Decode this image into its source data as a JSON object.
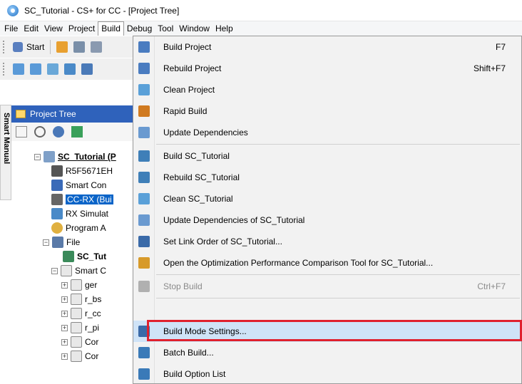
{
  "window": {
    "title": "SC_Tutorial - CS+ for CC - [Project Tree]"
  },
  "menubar": {
    "items": [
      "File",
      "Edit",
      "View",
      "Project",
      "Build",
      "Debug",
      "Tool",
      "Window",
      "Help"
    ],
    "open_item": "Build"
  },
  "toolbar": {
    "start_label": "Start"
  },
  "side_tab": {
    "label": "Smart Manual"
  },
  "project_tree": {
    "title": "Project Tree",
    "nodes": [
      "SC_Tutorial (P",
      "R5F5671EH",
      "Smart Con",
      "CC-RX (Bui",
      "RX Simulat",
      "Program A",
      "File",
      "SC_Tut",
      "Smart C",
      "ger",
      "r_bs",
      "r_cc",
      "r_pi",
      "Cor",
      "Cor"
    ]
  },
  "build_menu": {
    "items": [
      {
        "label": "Build Project",
        "shortcut": "F7",
        "icon": "build-icon",
        "color": "#4a7cc0",
        "disabled": false
      },
      {
        "label": "Rebuild Project",
        "shortcut": "Shift+F7",
        "icon": "rebuild-icon",
        "color": "#4a7cc0",
        "disabled": false
      },
      {
        "label": "Clean Project",
        "shortcut": "",
        "icon": "clean-icon",
        "color": "#5aa0d8",
        "disabled": false
      },
      {
        "label": "Rapid Build",
        "shortcut": "",
        "icon": "rapid-build-icon",
        "color": "#d07a20",
        "disabled": false
      },
      {
        "label": "Update Dependencies",
        "shortcut": "",
        "icon": "update-dependencies-icon",
        "color": "#6a9ad0",
        "disabled": false
      },
      {
        "label": "Build SC_Tutorial",
        "shortcut": "",
        "icon": "build-file-icon",
        "color": "#3f7fb8",
        "disabled": false
      },
      {
        "label": "Rebuild SC_Tutorial",
        "shortcut": "",
        "icon": "rebuild-file-icon",
        "color": "#3f7fb8",
        "disabled": false
      },
      {
        "label": "Clean SC_Tutorial",
        "shortcut": "",
        "icon": "clean-file-icon",
        "color": "#5aa0d8",
        "disabled": false
      },
      {
        "label": "Update Dependencies of SC_Tutorial",
        "shortcut": "",
        "icon": "update-dependencies-file-icon",
        "color": "#6a9ad0",
        "disabled": false
      },
      {
        "label": "Set Link Order of SC_Tutorial...",
        "shortcut": "",
        "icon": "link-order-icon",
        "color": "#3a6aa8",
        "disabled": false
      },
      {
        "label": "Open the Optimization Performance Comparison Tool for SC_Tutorial...",
        "shortcut": "",
        "icon": "chart-icon",
        "color": "#d79a2a",
        "disabled": false
      },
      {
        "label": "Stop Build",
        "shortcut": "Ctrl+F7",
        "icon": "stop-build-icon",
        "color": "#9a9a9a",
        "disabled": true
      },
      {
        "label": "Build Mode Settings...",
        "shortcut": "",
        "icon": "build-mode-icon",
        "color": "#3a6aa8",
        "disabled": false,
        "highlighted": true
      },
      {
        "label": "Batch Build...",
        "shortcut": "",
        "icon": "batch-build-icon",
        "color": "#3a7ab8",
        "disabled": false
      },
      {
        "label": "Build Option List",
        "shortcut": "",
        "icon": "build-option-icon",
        "color": "#3a7ab8",
        "disabled": false
      }
    ]
  },
  "colors": {
    "tree_header": "#2f62bb",
    "selection": "#0a64c8",
    "highlight_box": "#e0212e"
  }
}
